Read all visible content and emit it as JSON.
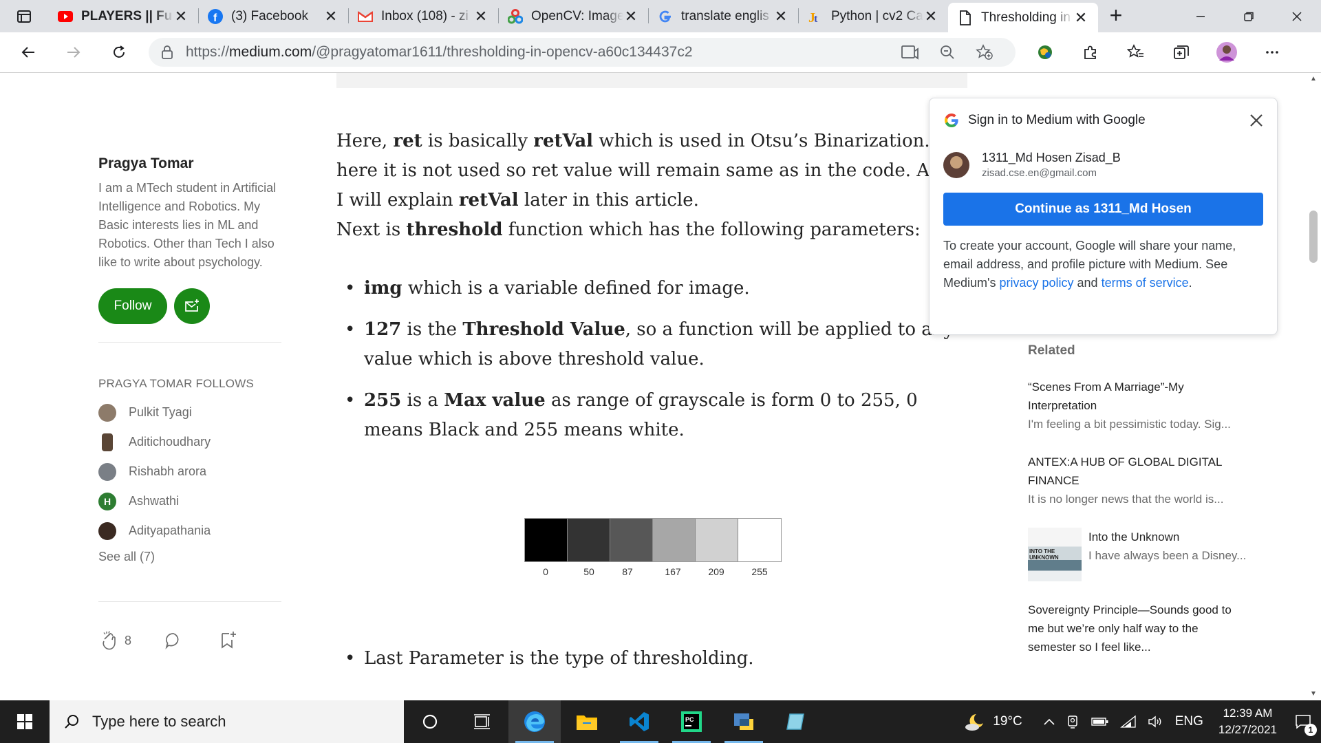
{
  "browser": {
    "tabs": [
      {
        "title": "PLAYERS || Full",
        "favicon": "youtube-icon",
        "bold": true
      },
      {
        "title": "(3) Facebook",
        "favicon": "facebook-icon",
        "bold": false
      },
      {
        "title": "Inbox (108) - zi",
        "favicon": "gmail-icon",
        "bold": false
      },
      {
        "title": "OpenCV: Image",
        "favicon": "opencv-icon",
        "bold": false
      },
      {
        "title": "translate englis",
        "favicon": "google-icon",
        "bold": false
      },
      {
        "title": "Python | cv2 Ca",
        "favicon": "javatpoint-icon",
        "bold": false
      },
      {
        "title": "Thresholding in",
        "favicon": "page-icon",
        "bold": false,
        "active": true
      }
    ],
    "url_prefix": "https://",
    "url_host": "medium.com",
    "url_path": "/@pragyatomar1611/thresholding-in-opencv-a60c134437c2"
  },
  "author": {
    "name": "Pragya Tomar",
    "bio": "I am a MTech student in Artificial Intelligence and Robotics. My Basic interests lies in ML and Robotics. Other than Tech I also like to write about psychology.",
    "follow_label": "Follow",
    "follows_heading": "PRAGYA TOMAR FOLLOWS",
    "follows": [
      {
        "name": "Pulkit Tyagi",
        "avatar_color": "#8d7b6a",
        "initial": ""
      },
      {
        "name": "Aditichoudhary",
        "avatar_color": "#5a4636",
        "initial": ""
      },
      {
        "name": "Rishabh arora",
        "avatar_color": "#7a7f86",
        "initial": ""
      },
      {
        "name": "Ashwathi",
        "avatar_color": "#2e7d32",
        "initial": "H"
      },
      {
        "name": "Adityapathania",
        "avatar_color": "#3b2a22",
        "initial": ""
      }
    ],
    "see_all": "See all (7)",
    "clap_count": "8"
  },
  "article": {
    "para1_a": "Here, ",
    "para1_b": "ret",
    "para1_c": " is basically ",
    "para1_d": "retVal",
    "para1_e": " which is used in Otsu’s Binarization. But here it is not used so ret value will remain same as in the code. And, I will explain ",
    "para1_f": "retVal",
    "para1_g": " later in this article.",
    "para2_a": "Next is ",
    "para2_b": "threshold",
    "para2_c": " function which has the following parameters:",
    "b1_a": "img",
    "b1_b": " which is a variable defined for image.",
    "b2_a": "127",
    "b2_b": " is the ",
    "b2_c": "Threshold Value",
    "b2_d": ", so a function will be applied to any value which is above threshold value.",
    "b3_a": "255",
    "b3_b": " is a ",
    "b3_c": "Max value",
    "b3_d": " as range of grayscale is form 0 to 255, 0 means Black and 255 means white.",
    "last_param": "Last Parameter is the type of thresholding."
  },
  "grayscale_figure": {
    "swatches": [
      "#000000",
      "#333333",
      "#575757",
      "#a7a7a7",
      "#d1d1d1",
      "#ffffff"
    ],
    "labels": [
      "0",
      "50",
      "87",
      "167",
      "209",
      "255"
    ]
  },
  "related": {
    "heading": "Related",
    "items": [
      {
        "title": "“Scenes From A Marriage”-My Interpretation",
        "sub": "I'm feeling a bit pessimistic today. Sig..."
      },
      {
        "title": "ANTEX:A HUB OF GLOBAL DIGITAL FINANCE",
        "sub": "It is no longer news that the world is..."
      },
      {
        "title": "Into the Unknown",
        "sub": "I have always been a Disney...",
        "thumb_text": "INTO THE UNKNOWN"
      },
      {
        "title": "Sovereignty Principle—Sounds good to me but we’re only half way to the semester so I feel like...",
        "sub": ""
      }
    ]
  },
  "google_popup": {
    "title": "Sign in to Medium with Google",
    "account_name": "1311_Md Hosen Zisad_B",
    "account_email": "zisad.cse.en@gmail.com",
    "continue_label": "Continue as 1311_Md Hosen",
    "disclaimer_a": "To create your account, Google will share your name, email address, and profile picture with Medium. See Medium's ",
    "privacy_link": "privacy policy",
    "disclaimer_b": " and ",
    "terms_link": "terms of service",
    "disclaimer_c": "."
  },
  "taskbar": {
    "search_placeholder": "Type here to search",
    "weather": "19°C",
    "language": "ENG",
    "time": "12:39 AM",
    "date": "12/27/2021",
    "notification_count": "1"
  }
}
